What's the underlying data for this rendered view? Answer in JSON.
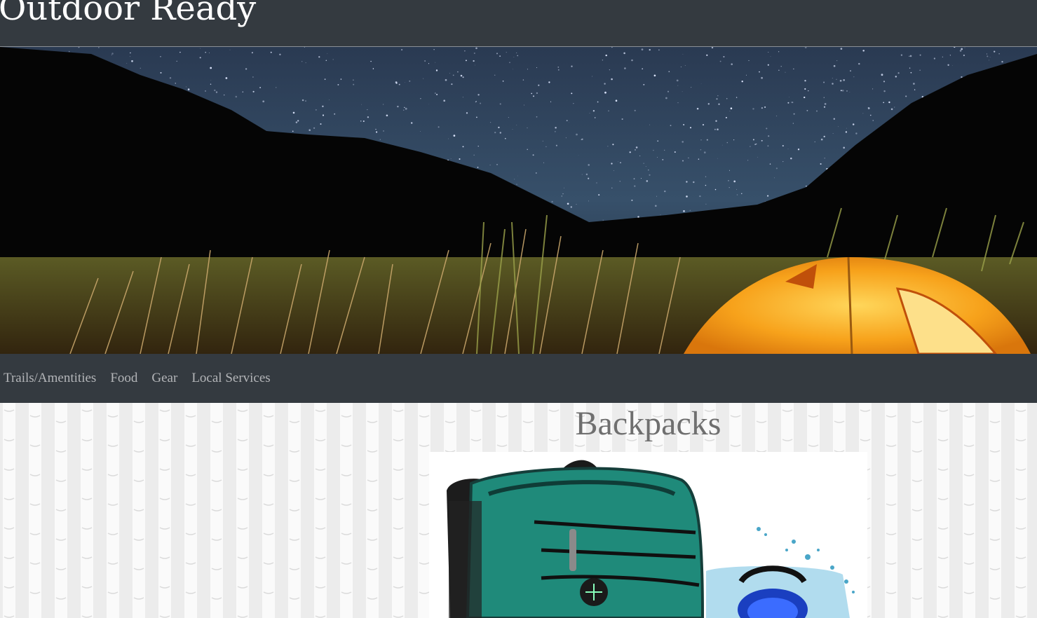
{
  "site": {
    "title": "Outdoor Ready"
  },
  "nav": {
    "items": [
      {
        "label": "Trails/Amentities"
      },
      {
        "label": "Food"
      },
      {
        "label": "Gear"
      },
      {
        "label": "Local Services"
      }
    ]
  },
  "main": {
    "section_title": "Backpacks"
  },
  "colors": {
    "header_bg": "#343a40",
    "title_text": "#ffffff",
    "nav_text": "#b3b5b8",
    "section_title_text": "#6f6f6f",
    "page_bg": "#ececec",
    "backpack_teal": "#1f8a7a",
    "tent_orange": "#f7a21b"
  }
}
